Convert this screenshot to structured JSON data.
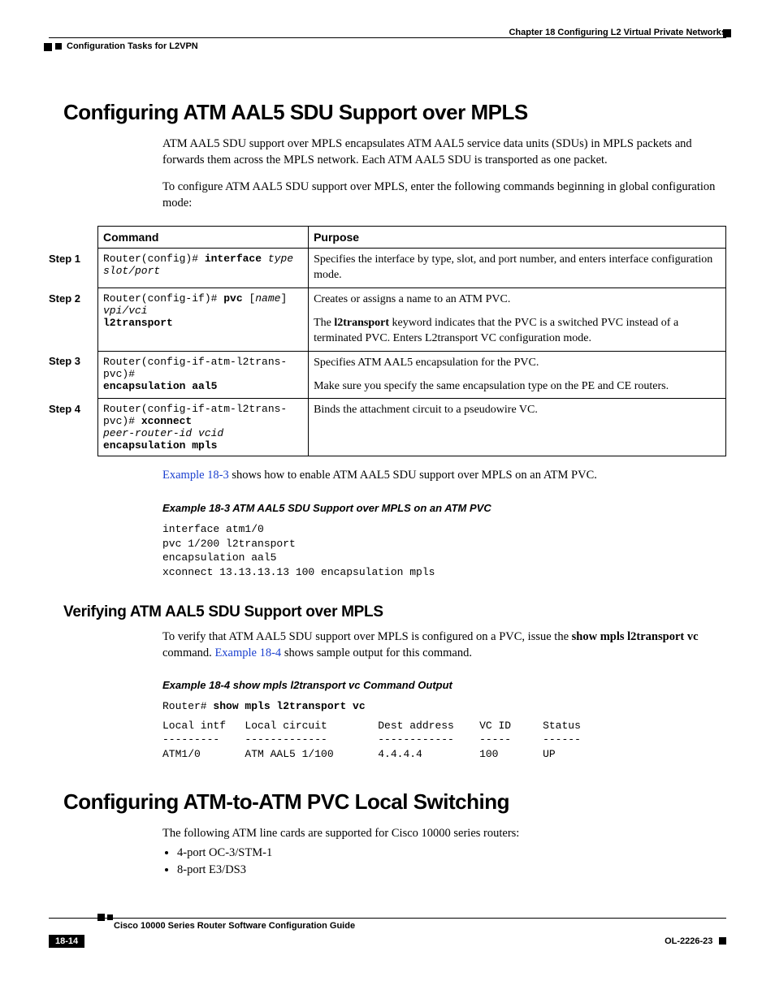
{
  "header": {
    "chapter": "Chapter 18    Configuring L2 Virtual Private Networks",
    "section": "Configuration Tasks for L2VPN"
  },
  "h1_a": "Configuring ATM AAL5 SDU Support over MPLS",
  "intro": {
    "p1": "ATM AAL5 SDU support over MPLS encapsulates ATM AAL5 service data units (SDUs) in MPLS packets and forwards them across the MPLS network. Each ATM AAL5 SDU is transported as one packet.",
    "p2": "To configure ATM AAL5 SDU support over MPLS, enter the following commands beginning in global configuration mode:"
  },
  "table": {
    "hdr_command": "Command",
    "hdr_purpose": "Purpose",
    "rows": [
      {
        "step": "Step 1",
        "cmd_prefix": "Router(config)# ",
        "cmd_kw": "interface",
        "cmd_arg": " type slot/port",
        "purpose1": "Specifies the interface by type, slot, and port number, and enters interface configuration mode."
      },
      {
        "step": "Step 2",
        "cmd_prefix": "Router(config-if)# ",
        "cmd_kw": "pvc",
        "cmd_mid": " [",
        "cmd_arg": "name",
        "cmd_mid2": "] ",
        "cmd_arg2": "vpi/vci",
        "cmd_kw2": "l2transport",
        "purpose1": "Creates or assigns a name to an ATM PVC.",
        "purpose2a": "The ",
        "purpose2b": "l2transport",
        "purpose2c": " keyword indicates that the PVC is a switched PVC instead of a terminated PVC. Enters L2transport VC configuration mode."
      },
      {
        "step": "Step 3",
        "cmd_prefix": "Router(config-if-atm-l2trans-pvc)# ",
        "cmd_kw": "encapsulation aal5",
        "purpose1": "Specifies ATM AAL5 encapsulation for the PVC.",
        "purpose2": "Make sure you specify the same encapsulation type on the PE and CE routers."
      },
      {
        "step": "Step 4",
        "cmd_prefix": "Router(config-if-atm-l2trans-pvc)# ",
        "cmd_kw": "xconnect",
        "cmd_arg": "peer-router-id vcid",
        "cmd_kw2": " encapsulation mpls",
        "purpose1": "Binds the attachment circuit to a pseudowire VC."
      }
    ]
  },
  "after_table": {
    "link": "Example 18-3",
    "rest": " shows how to enable ATM AAL5 SDU support over MPLS on an ATM PVC."
  },
  "example3": {
    "caption": "Example 18-3   ATM AAL5 SDU Support over MPLS on an ATM PVC",
    "code": "interface atm1/0\npvc 1/200 l2transport\nencapsulation aal5\nxconnect 13.13.13.13 100 encapsulation mpls"
  },
  "h2_verify": "Verifying ATM AAL5 SDU Support over MPLS",
  "verify": {
    "pA": "To verify that ATM AAL5 SDU support over MPLS is configured on a PVC, issue the ",
    "pB": "show mpls l2transport vc",
    "pC": " command. ",
    "link": "Example 18-4",
    "pD": " shows sample output for this command."
  },
  "example4": {
    "caption": "Example 18-4   show mpls l2transport vc Command Output",
    "prompt": "Router# ",
    "cmd": "show mpls l2transport vc",
    "out": "Local intf   Local circuit        Dest address    VC ID     Status\n---------    -------------        ------------    -----     ------\nATM1/0       ATM AAL5 1/100       4.4.4.4         100       UP"
  },
  "h1_b": "Configuring ATM-to-ATM PVC Local Switching",
  "atm2atm": {
    "p": "The following ATM line cards are supported for Cisco 10000 series routers:",
    "bullets": [
      "4-port OC-3/STM-1",
      "8-port E3/DS3"
    ]
  },
  "footer": {
    "guide": "Cisco 10000 Series Router Software Configuration Guide",
    "page": "18-14",
    "ol": "OL-2226-23"
  }
}
